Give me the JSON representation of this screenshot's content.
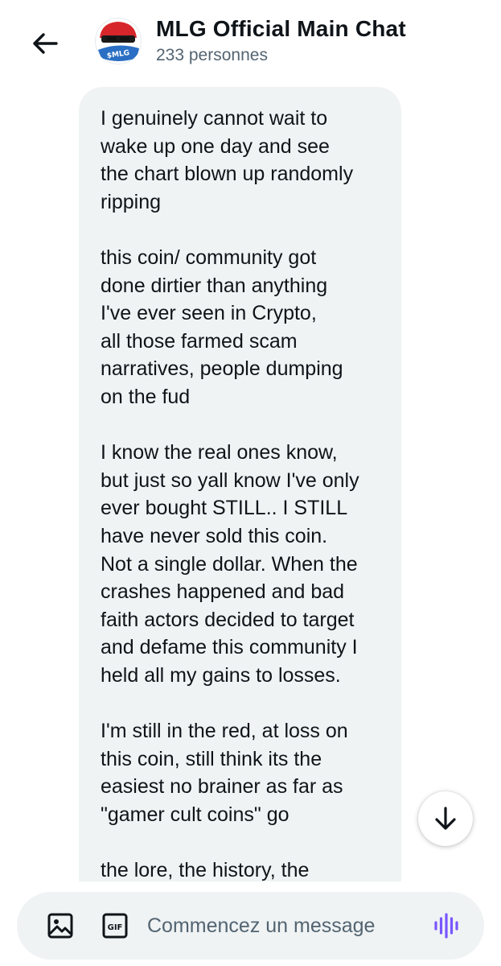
{
  "header": {
    "title": "MLG Official Main Chat",
    "subtitle": "233 personnes",
    "avatar_text": "$MLG",
    "icons": {
      "back": "arrow-left-icon",
      "avatar": "group-avatar"
    }
  },
  "message": {
    "lines": [
      "I genuinely cannot wait to",
      "wake up one day and see",
      "the chart blown up randomly",
      "ripping",
      "",
      "this coin/ community got",
      "done dirtier than anything",
      "I've ever seen in Crypto,",
      "all those farmed scam",
      "narratives, people dumping",
      "on the fud",
      "",
      "I know the real ones know,",
      "but just so yall know I've only",
      "ever bought STILL.. I STILL",
      "have never sold this coin.",
      "Not a single dollar. When the",
      "crashes happened and bad",
      "faith actors decided to target",
      "and defame this community I",
      "held all my gains to losses.",
      "",
      "I'm still in the red, at loss on",
      "this coin, still think its the",
      "easiest no brainer as far as",
      "\"gamer cult coins\" go",
      "",
      "the lore, the history, the"
    ]
  },
  "scroll_button": {
    "icon": "arrow-down-icon"
  },
  "composer": {
    "placeholder": "Commencez un message",
    "value": "",
    "gif_label": "GIF",
    "icons": {
      "media": "image-icon",
      "gif": "gif-icon",
      "voice": "voice-wave-icon"
    },
    "voice_color": "#7856ff"
  },
  "colors": {
    "text": "#0f1419",
    "secondary_text": "#536471",
    "bubble_bg": "#eff3f4",
    "brand_red": "#d7262b"
  }
}
